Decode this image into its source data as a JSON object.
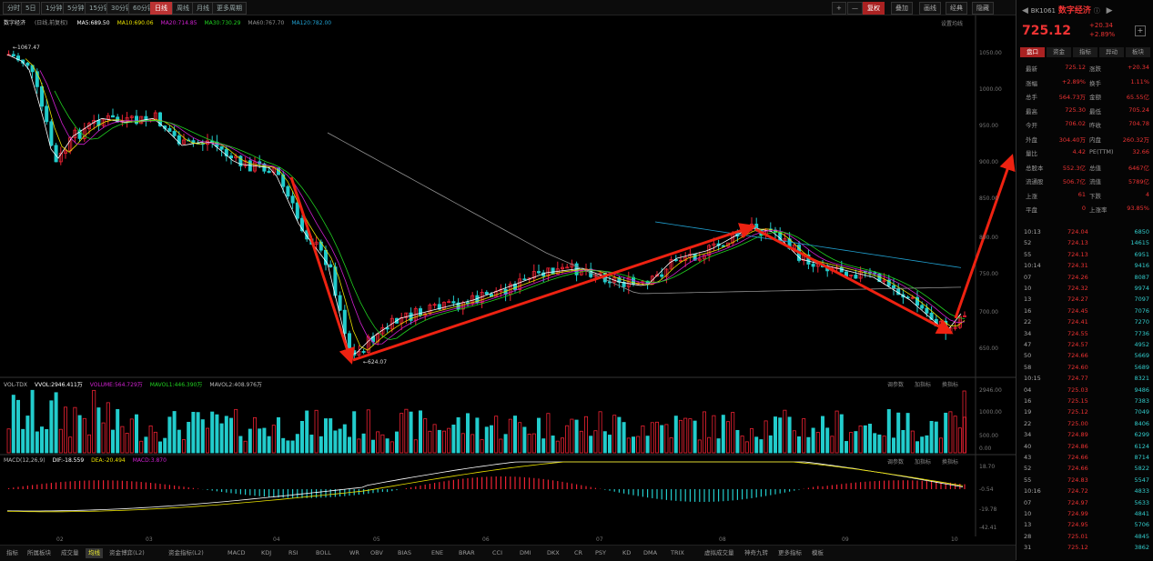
{
  "topbar": {
    "tabs": [
      "分时",
      "5日",
      "1分钟",
      "5分钟",
      "15分钟",
      "30分钟",
      "60分钟",
      "日线",
      "周线",
      "月线",
      "更多周期"
    ],
    "active_tab": 7,
    "right_buttons": [
      "+",
      "—",
      "复权",
      "叠加",
      "画线",
      "经典",
      "隐藏"
    ],
    "right_red_index": 2
  },
  "chart_header": {
    "name": "数字经济",
    "mode": "(日线,前复权)",
    "ma_legend": [
      {
        "label": "MA5:689.50",
        "color": "#ffffff"
      },
      {
        "label": "MA10:690.06",
        "color": "#e8e000"
      },
      {
        "label": "MA20:714.85",
        "color": "#d020d0"
      },
      {
        "label": "MA30:730.29",
        "color": "#20d020"
      },
      {
        "label": "MA60:767.70",
        "color": "#909090"
      },
      {
        "label": "MA120:782.00",
        "color": "#20a0d0"
      }
    ],
    "settings": "设置均线",
    "high_label": "1067.47",
    "low_label": "624.07"
  },
  "price_axis": [
    "1050.00",
    "1000.00",
    "950.00",
    "900.00",
    "850.00",
    "800.00",
    "750.00",
    "700.00",
    "650.00"
  ],
  "vol_header": {
    "legend": [
      {
        "label": "VOL-TDX",
        "color": "#bbbbbb"
      },
      {
        "label": "VVOL:2946.411万",
        "color": "#ffffff"
      },
      {
        "label": "VOLUME:564.729万",
        "color": "#d020d0"
      },
      {
        "label": "MAVOL1:446.390万",
        "color": "#20d020"
      },
      {
        "label": "MAVOL2:408.976万",
        "color": "#bbbbbb"
      }
    ],
    "controls": [
      "调参数",
      "加指标",
      "换指标"
    ],
    "axis": [
      "2946.00",
      "1000.00",
      "500.00",
      "0.00"
    ]
  },
  "macd_header": {
    "legend": [
      {
        "label": "MACD(12,26,9)",
        "color": "#bbbbbb"
      },
      {
        "label": "DIF:-18.559",
        "color": "#ffffff"
      },
      {
        "label": "DEA:-20.494",
        "color": "#e8e000"
      },
      {
        "label": "MACD:3.870",
        "color": "#d020d0"
      }
    ],
    "controls": [
      "调参数",
      "加指标",
      "换指标"
    ],
    "axis": [
      "18.70",
      "-0.54",
      "-19.78",
      "-42.41"
    ]
  },
  "x_labels": [
    "02",
    "03",
    "04",
    "05",
    "06",
    "07",
    "08",
    "09",
    "10"
  ],
  "bottom_tabs": [
    "指标",
    "所属板块",
    "成交量",
    "均线",
    "资金博弈(L2)",
    "资金指标(L2)",
    "MACD",
    "KDJ",
    "RSI",
    "BOLL",
    "WR",
    "OBV",
    "BIAS",
    "ENE",
    "BRAR",
    "CCI",
    "DMI",
    "DKX",
    "CR",
    "PSY",
    "KD",
    "DMA",
    "TRIX",
    "虚拟成交量",
    "神奇九转",
    "更多指标",
    "模板"
  ],
  "bottom_active": 3,
  "sidebar": {
    "code": "BK1061",
    "name": "数字经济",
    "price": "725.12",
    "change": "+20.34",
    "change_pct": "+2.89%",
    "tabs": [
      "盘口",
      "资金",
      "指标",
      "异动",
      "板块"
    ],
    "quote": [
      [
        "最新",
        "725.12",
        "涨跌",
        "+20.34"
      ],
      [
        "涨幅",
        "+2.89%",
        "换手",
        "1.11%"
      ],
      [
        "总手",
        "564.73万",
        "金额",
        "65.55亿"
      ],
      [
        "最高",
        "725.30",
        "最低",
        "705.24"
      ],
      [
        "今开",
        "706.02",
        "昨收",
        "704.78"
      ],
      [
        "外盘",
        "304.40万",
        "内盘",
        "260.32万"
      ],
      [
        "量比",
        "4.42",
        "PE(TTM)",
        "32.66"
      ],
      [
        "总股本",
        "552.3亿",
        "总值",
        "6467亿"
      ],
      [
        "流通股",
        "506.7亿",
        "流值",
        "5789亿"
      ],
      [
        "上涨",
        "61",
        "下跌",
        "4"
      ],
      [
        "平盘",
        "0",
        "上涨率",
        "93.85%"
      ]
    ],
    "trades": [
      [
        "10:13",
        "724.04",
        "6850"
      ],
      [
        "52",
        "724.13",
        "14615"
      ],
      [
        "55",
        "724.13",
        "6951"
      ],
      [
        "10:14",
        "724.31",
        "9416"
      ],
      [
        "07",
        "724.26",
        "8087"
      ],
      [
        "10",
        "724.32",
        "9974"
      ],
      [
        "13",
        "724.27",
        "7097"
      ],
      [
        "16",
        "724.45",
        "7076"
      ],
      [
        "22",
        "724.41",
        "7270"
      ],
      [
        "34",
        "724.55",
        "7736"
      ],
      [
        "47",
        "724.57",
        "4952"
      ],
      [
        "50",
        "724.66",
        "5669"
      ],
      [
        "58",
        "724.60",
        "5689"
      ],
      [
        "10:15",
        "724.77",
        "8321"
      ],
      [
        "04",
        "725.03",
        "9486"
      ],
      [
        "16",
        "725.15",
        "7383"
      ],
      [
        "19",
        "725.12",
        "7049"
      ],
      [
        "22",
        "725.00",
        "8406"
      ],
      [
        "34",
        "724.89",
        "6299"
      ],
      [
        "40",
        "724.86",
        "6124"
      ],
      [
        "43",
        "724.66",
        "8714"
      ],
      [
        "52",
        "724.66",
        "5822"
      ],
      [
        "55",
        "724.83",
        "5547"
      ],
      [
        "10:16",
        "724.72",
        "4833"
      ],
      [
        "07",
        "724.97",
        "5633"
      ],
      [
        "10",
        "724.99",
        "4841"
      ],
      [
        "13",
        "724.95",
        "5706"
      ],
      [
        "28",
        "725.01",
        "4845"
      ],
      [
        "31",
        "725.12",
        "3862"
      ]
    ]
  }
}
